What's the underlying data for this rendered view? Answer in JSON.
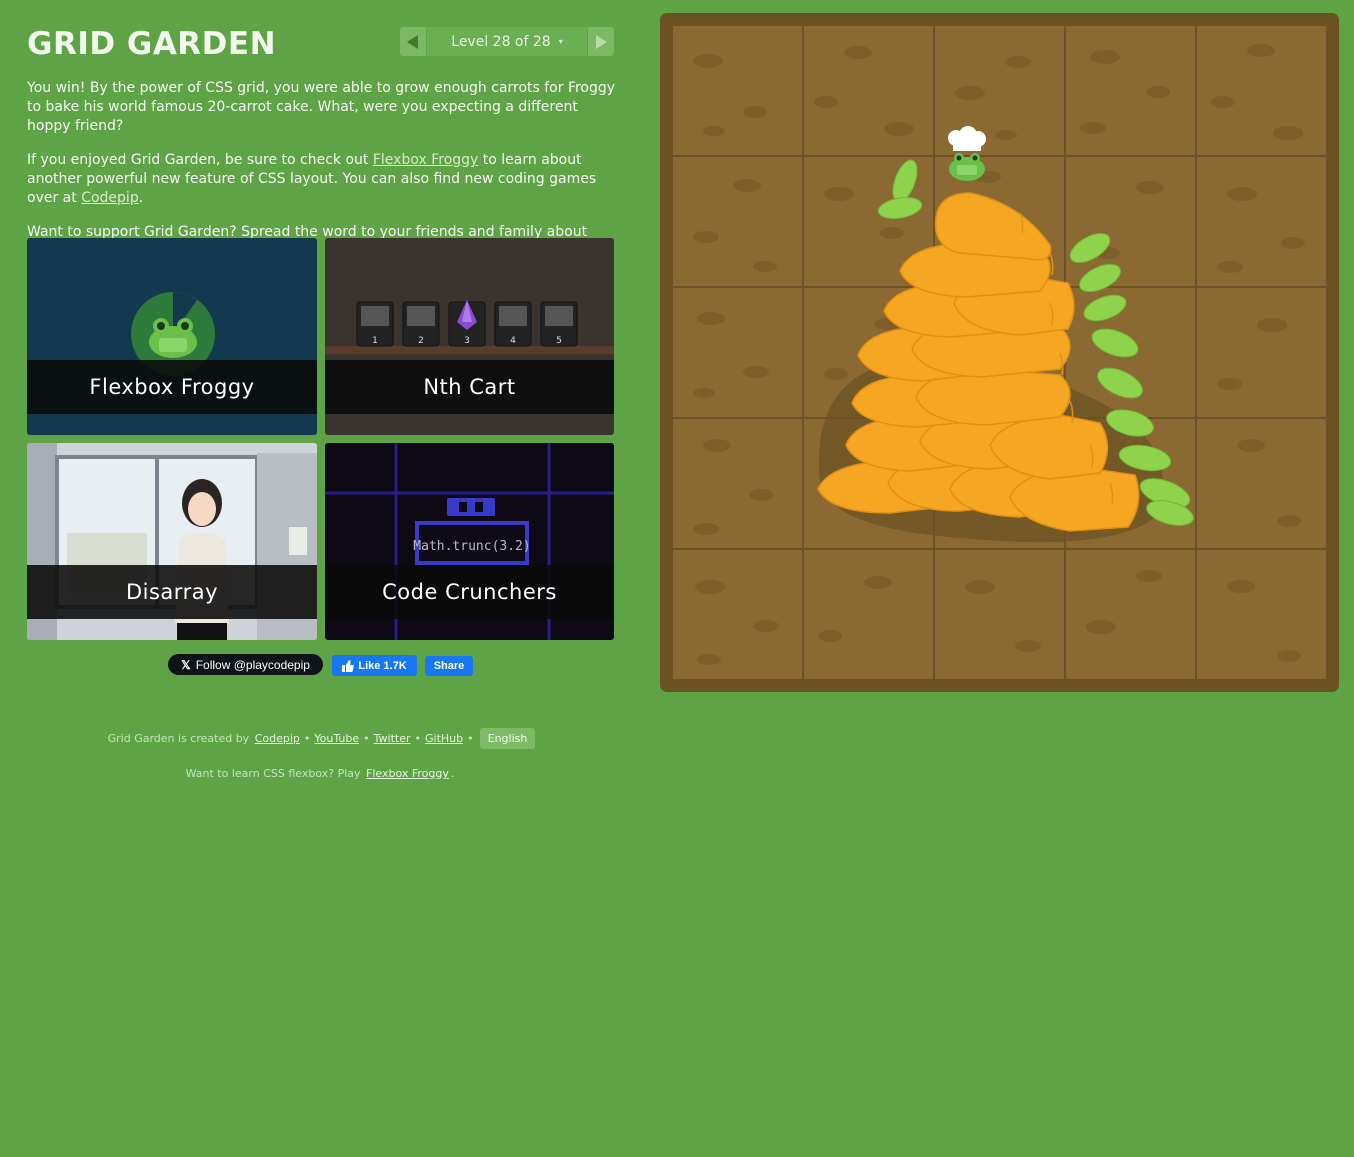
{
  "header": {
    "title": "GRID GARDEN",
    "level_label": "Level 28 of 28",
    "caret": "▾"
  },
  "intro": {
    "p1": "You win! By the power of CSS grid, you were able to grow enough carrots for Froggy to bake his world famous 20-carrot cake. What, were you expecting a different hoppy friend?",
    "p2_before": "If you enjoyed Grid Garden, be sure to check out ",
    "p2_link1": "Flexbox Froggy",
    "p2_middle": " to learn about another powerful new feature of CSS layout. You can also find new coding games over at ",
    "p2_link2": "Codepip",
    "p2_after": ".",
    "p3": "Want to support Grid Garden? Spread the word to your friends and family about Grid Garden!"
  },
  "cards": [
    {
      "label": "Flexbox Froggy"
    },
    {
      "label": "Nth Cart"
    },
    {
      "label": "Disarray"
    },
    {
      "label": "Code Crunchers"
    }
  ],
  "nthcart_numbers": [
    "1",
    "2",
    "3",
    "4",
    "5"
  ],
  "crunchers_code": "Math.trunc(3.2)",
  "social": {
    "follow_label": "Follow @playcodepip",
    "x_glyph": "𝕏",
    "like_label": "Like 1.7K",
    "share_label": "Share"
  },
  "footer": {
    "created_by": "Grid Garden is created by",
    "links": [
      "Codepip",
      "YouTube",
      "Twitter",
      "GitHub"
    ],
    "separator": "•",
    "language": "English",
    "flexbox_prompt": "Want to learn CSS flexbox? Play ",
    "flexbox_link": "Flexbox Froggy",
    "flexbox_end": "."
  },
  "colors": {
    "background": "#5ea446",
    "soil": "#8a6a32",
    "carrot": "#f5a623",
    "leaf": "#8fd34d"
  }
}
